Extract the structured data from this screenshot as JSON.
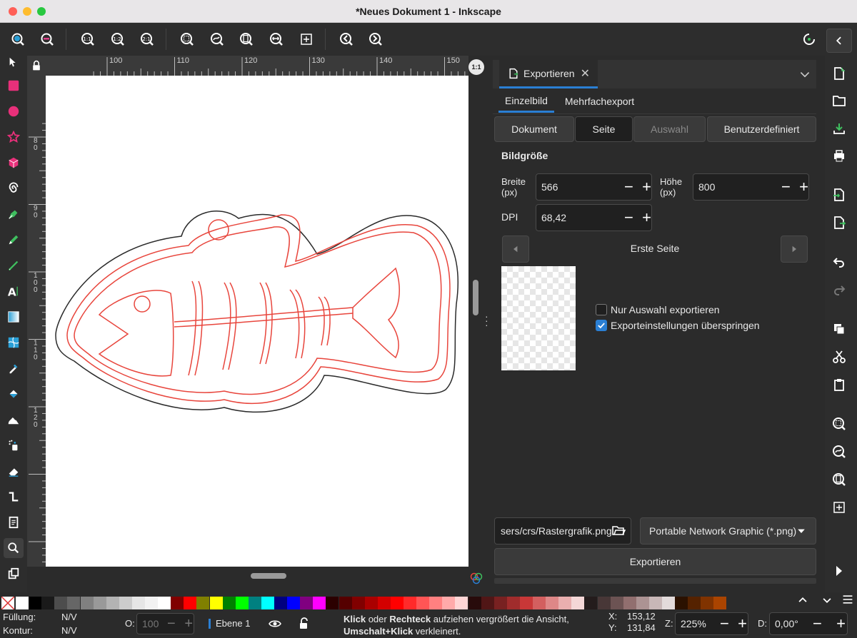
{
  "window": {
    "title": "*Neues Dokument 1 - Inkscape"
  },
  "commands": [
    {
      "name": "zoom-in-icon"
    },
    {
      "name": "zoom-out-icon"
    },
    {
      "name": "zoom-1-1-icon",
      "text": "1:1"
    },
    {
      "name": "zoom-1-2-icon",
      "text": "1:2"
    },
    {
      "name": "zoom-2-1-icon",
      "text": "2:1"
    },
    {
      "name": "zoom-selection-icon"
    },
    {
      "name": "zoom-drawing-icon"
    },
    {
      "name": "zoom-page-icon"
    },
    {
      "name": "zoom-page-width-icon"
    },
    {
      "name": "zoom-center-page-icon"
    },
    {
      "name": "zoom-previous-icon"
    },
    {
      "name": "zoom-next-icon"
    }
  ],
  "ruler": {
    "h": [
      "100",
      "110",
      "120",
      "130",
      "140",
      "150"
    ],
    "v": [
      "80",
      "90",
      "100",
      "110",
      "120"
    ]
  },
  "dialog": {
    "tab_title": "Exportieren",
    "subtabs": [
      "Einzelbild",
      "Mehrfachexport"
    ],
    "area_buttons": [
      "Dokument",
      "Seite",
      "Auswahl",
      "Benutzerdefiniert"
    ],
    "image_size_heading": "Bildgröße",
    "width_label": "Breite\n(px)",
    "width_value": "566",
    "height_label": "Höhe\n(px)",
    "height_value": "800",
    "dpi_label": "DPI",
    "dpi_value": "68,42",
    "page_nav": "Erste Seite",
    "checkbox_selection": {
      "label": "Nur Auswahl exportieren",
      "checked": false
    },
    "checkbox_skip": {
      "label": "Exporteinstellungen überspringen",
      "checked": true
    },
    "filename": "sers/crs/Rastergrafik.png",
    "filetype": "Portable Network Graphic (*.png)",
    "export_button": "Exportieren"
  },
  "colors": {
    "accent": "#2a7fd4",
    "stroke_red": "#e8453c",
    "stroke_dark": "#2a2a2a"
  },
  "palette": [
    "#ffffff",
    "#000000",
    "#1a1a1a",
    "#4d4d4d",
    "#666666",
    "#808080",
    "#999999",
    "#b3b3b3",
    "#cccccc",
    "#e6e6e6",
    "#f2f2f2",
    "#ffffff",
    "#800000",
    "#ff0000",
    "#808000",
    "#ffff00",
    "#008000",
    "#00ff00",
    "#008080",
    "#00ffff",
    "#000080",
    "#0000ff",
    "#800080",
    "#ff00ff",
    "#2b0000",
    "#550000",
    "#800000",
    "#aa0000",
    "#d40000",
    "#ff0000",
    "#ff2a2a",
    "#ff5555",
    "#ff8080",
    "#ffaaaa",
    "#ffd5d5",
    "#280b0b",
    "#501616",
    "#782121",
    "#a02c2c",
    "#c83737",
    "#d35f5f",
    "#de8787",
    "#e9afaf",
    "#f4d7d7",
    "#241c1c",
    "#483737",
    "#6c5353",
    "#916f6f",
    "#ac9393",
    "#c8b7b7",
    "#e3dbdb",
    "#2b1100",
    "#552200",
    "#803300",
    "#aa4400"
  ],
  "status": {
    "fill_label": "Füllung:",
    "fill_value": "N/V",
    "stroke_label": "Kontur:",
    "stroke_value": "N/V",
    "opacity_label": "O:",
    "opacity_value": "100",
    "layer": "Ebene 1",
    "message_bold1": "Klick",
    "message_1": " oder ",
    "message_bold2": "Rechteck",
    "message_2": " aufziehen vergrößert die Ansicht,",
    "message_bold3": "Umschalt+Klick",
    "message_3": " verkleinert.",
    "x_label": "X:",
    "x_value": "153,12",
    "y_label": "Y:",
    "y_value": "131,84",
    "zoom_label": "Z:",
    "zoom_value": "225%",
    "rot_label": "D:",
    "rot_value": "0,00°"
  }
}
